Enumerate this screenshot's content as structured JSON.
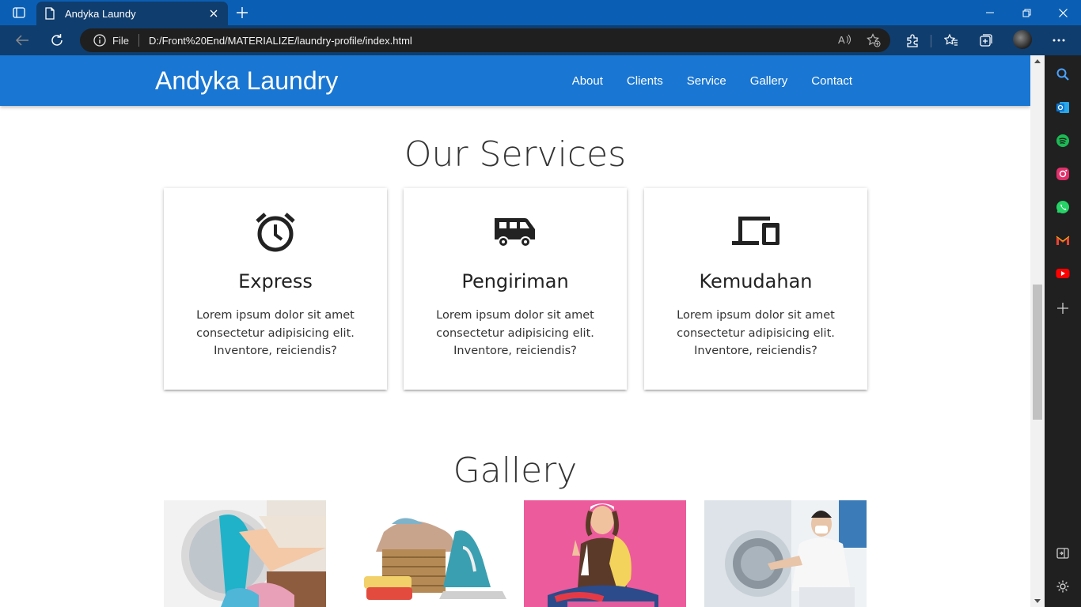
{
  "browser": {
    "tab_title": "Andyka Laundy",
    "scheme_label": "File",
    "url": "D:/Front%20End/MATERIALIZE/laundry-profile/index.html",
    "icons": [
      "tab-actions-icon",
      "page-icon",
      "close-icon",
      "plus-icon",
      "minimize-icon",
      "restore-icon",
      "window-close-icon",
      "back-icon",
      "refresh-icon",
      "info-icon",
      "read-aloud-icon",
      "favorite-add-icon",
      "extensions-icon",
      "favorites-icon",
      "collections-icon",
      "more-icon"
    ]
  },
  "sidebar": {
    "icons": [
      "search-icon",
      "outlook-icon",
      "spotify-icon",
      "instagram-icon",
      "whatsapp-icon",
      "gmail-icon",
      "youtube-icon",
      "add-icon",
      "split-screen-icon",
      "settings-icon"
    ],
    "colors": {
      "outlook": "#0f78d4",
      "spotify": "#1db954",
      "instagram": "#e1306c",
      "whatsapp": "#25d366",
      "gmail": "#ea4335",
      "youtube": "#ff0000"
    }
  },
  "navbar": {
    "brand": "Andyka Laundry",
    "links": [
      "About",
      "Clients",
      "Service",
      "Gallery",
      "Contact"
    ],
    "color": "#1976d2"
  },
  "services": {
    "title": "Our Services",
    "cards": [
      {
        "icon": "alarm-clock-icon",
        "title": "Express",
        "text": "Lorem ipsum dolor sit amet consectetur adipisicing elit. Inventore, reiciendis?"
      },
      {
        "icon": "van-icon",
        "title": "Pengiriman",
        "text": "Lorem ipsum dolor sit amet consectetur adipisicing elit. Inventore, reiciendis?"
      },
      {
        "icon": "devices-icon",
        "title": "Kemudahan",
        "text": "Lorem ipsum dolor sit amet consectetur adipisicing elit. Inventore, reiciendis?"
      }
    ]
  },
  "gallery": {
    "title": "Gallery",
    "photos": [
      "washing-machine-photo",
      "laundry-basket-iron-photo",
      "woman-holding-clothes-photo",
      "woman-laundromat-photo"
    ]
  }
}
